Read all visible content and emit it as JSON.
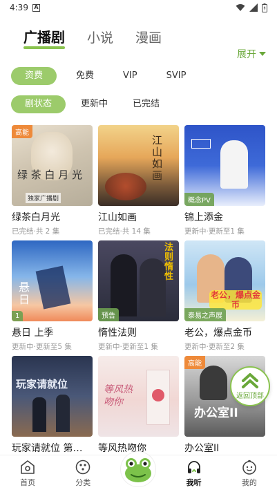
{
  "status": {
    "time": "4:39",
    "notif_icon": "A"
  },
  "top_tabs": [
    {
      "label": "广播剧"
    },
    {
      "label": "小说"
    },
    {
      "label": "漫画"
    }
  ],
  "expand_label": "展开",
  "filters_row1": [
    "资费",
    "免费",
    "VIP",
    "SVIP"
  ],
  "filters_row2": [
    "剧状态",
    "更新中",
    "已完结"
  ],
  "cards": [
    {
      "title": "绿茶白月光",
      "sub": "已完结·共 2 集",
      "badge": "高能",
      "badge_pos": "top",
      "cover_text": "绿 茶 白 月 光",
      "cover_sub": "独家广播剧"
    },
    {
      "title": "江山如画",
      "sub": "已完结·共 14 集",
      "badge": "",
      "badge_pos": "top",
      "cover_text": "江山如画"
    },
    {
      "title": "锦上添金",
      "sub": "更新中·更新至1 集",
      "badge": "概念PV",
      "badge_pos": "bottom",
      "cover_text": ""
    },
    {
      "title": "悬日 上季",
      "sub": "更新中·更新至5 集",
      "badge": "1",
      "badge_pos": "bottom",
      "cover_text": "悬日"
    },
    {
      "title": "惰性法则",
      "sub": "更新中·更新至1 集",
      "badge": "预告",
      "badge_pos": "bottom",
      "cover_text": "法则 惰性"
    },
    {
      "title": "老公，爆点金币",
      "sub": "更新中·更新至2 集",
      "badge": "泰易之声展",
      "badge_pos": "bottom",
      "cover_text": "老公，爆点金币"
    },
    {
      "title": "玩家请就位 第…",
      "sub": "",
      "badge": "",
      "badge_pos": "top",
      "cover_text": "玩家请就位"
    },
    {
      "title": "等风热吻你",
      "sub": "",
      "badge": "",
      "badge_pos": "top",
      "cover_text": "等风热吻你"
    },
    {
      "title": "办公室II",
      "sub": "",
      "badge": "高能",
      "badge_pos": "top",
      "cover_text": "办公室II"
    }
  ],
  "back_top_label": "返回顶部",
  "nav": [
    {
      "label": "首页",
      "icon": "home-icon"
    },
    {
      "label": "分类",
      "icon": "category-icon"
    },
    {
      "label": "",
      "icon": "frog-icon"
    },
    {
      "label": "我听",
      "icon": "headphone-icon"
    },
    {
      "label": "我的",
      "icon": "profile-icon"
    }
  ]
}
